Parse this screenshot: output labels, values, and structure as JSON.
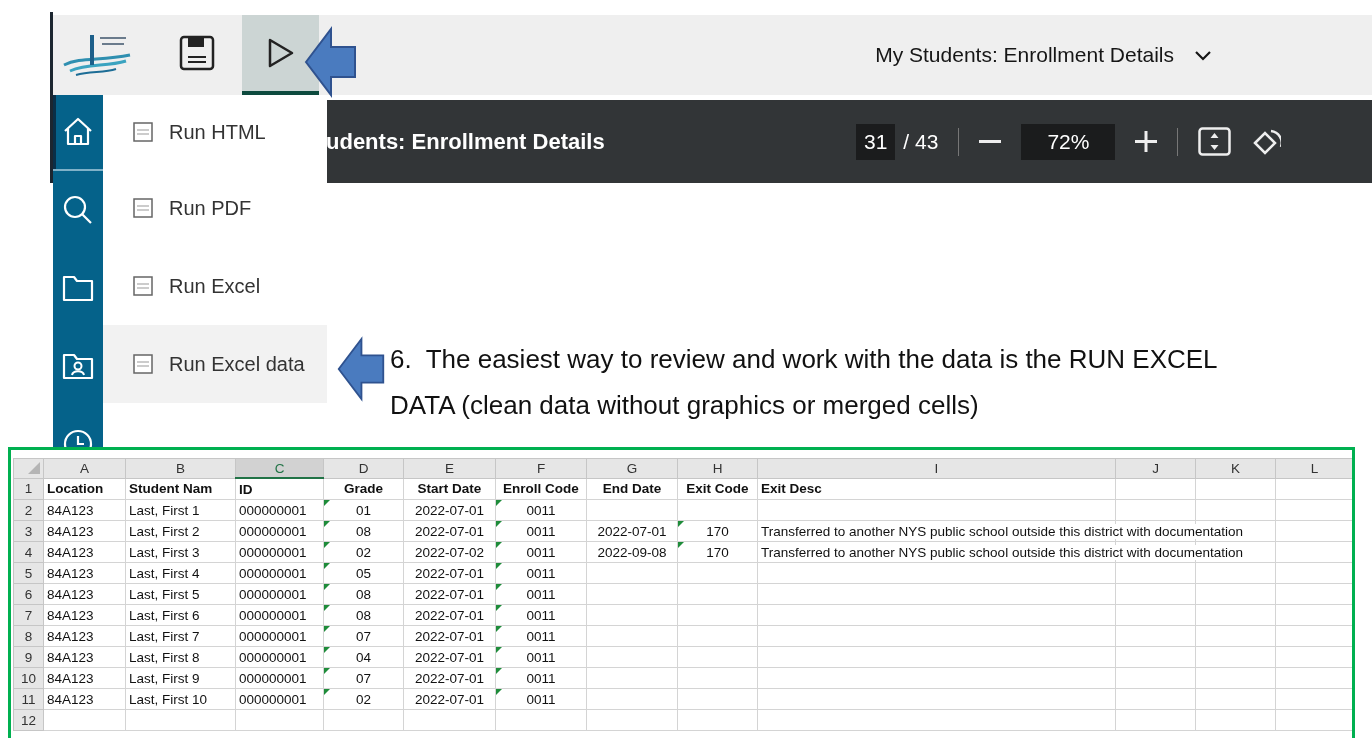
{
  "app_bar": {
    "buttons": [
      {
        "kind": "logo",
        "selected": false
      },
      {
        "kind": "save",
        "selected": false
      },
      {
        "kind": "run",
        "selected": true
      }
    ],
    "title": "My Students: Enrollment Details"
  },
  "sidebar": {
    "items": [
      {
        "kind": "home",
        "selected": true
      },
      {
        "kind": "search",
        "selected": false
      },
      {
        "kind": "folder",
        "selected": false
      },
      {
        "kind": "folder-user",
        "selected": false
      },
      {
        "kind": "clock",
        "selected": false
      }
    ]
  },
  "run_menu": {
    "items": [
      {
        "label": "Run HTML",
        "highlighted": false
      },
      {
        "label": "Run PDF",
        "highlighted": false
      },
      {
        "label": "Run Excel",
        "highlighted": false
      },
      {
        "label": "Run Excel data",
        "highlighted": true
      }
    ]
  },
  "report_toolbar": {
    "title": "udents: Enrollment Details",
    "page": "31",
    "page_total": "/ 43",
    "zoom": "72%"
  },
  "instruction": "6.  The easiest way to review and work with the data is the RUN EXCEL DATA (clean data without graphics or merged cells)",
  "spreadsheet": {
    "columns": [
      {
        "letter": "A",
        "kind": "text",
        "selected": false
      },
      {
        "letter": "B",
        "kind": "text",
        "selected": false
      },
      {
        "letter": "C",
        "kind": "text",
        "selected": true
      },
      {
        "letter": "D",
        "kind": "code",
        "flagged": true,
        "selected": false
      },
      {
        "letter": "E",
        "kind": "code",
        "selected": false
      },
      {
        "letter": "F",
        "kind": "code",
        "flagged": true,
        "selected": false
      },
      {
        "letter": "G",
        "kind": "code",
        "selected": false
      },
      {
        "letter": "H",
        "kind": "code",
        "flagged": true,
        "selected": false
      },
      {
        "letter": "I",
        "kind": "text",
        "selected": false
      },
      {
        "letter": "J",
        "kind": "text",
        "selected": false
      },
      {
        "letter": "K",
        "kind": "text",
        "selected": false
      },
      {
        "letter": "L",
        "kind": "text",
        "selected": false
      }
    ],
    "header_row": {
      "number": "1",
      "cells": [
        "Location",
        "Student Nam",
        "ID",
        "Grade",
        "Start Date",
        "Enroll Code",
        "End Date",
        "Exit Code",
        "Exit Desc",
        "",
        "",
        ""
      ]
    },
    "rows": [
      {
        "number": "2",
        "cells": [
          "84A123",
          "Last, First 1",
          "000000001",
          "01",
          "2022-07-01",
          "0011",
          "",
          "",
          "",
          "",
          "",
          ""
        ]
      },
      {
        "number": "3",
        "cells": [
          "84A123",
          "Last, First 2",
          "000000001",
          "08",
          "2022-07-01",
          "0011",
          "2022-07-01",
          "170",
          "Transferred to another NYS public school outside this district with documentation",
          "",
          "",
          ""
        ]
      },
      {
        "number": "4",
        "cells": [
          "84A123",
          "Last, First 3",
          "000000001",
          "02",
          "2022-07-02",
          "0011",
          "2022-09-08",
          "170",
          "Transferred to another NYS public school outside this district with documentation",
          "",
          "",
          ""
        ]
      },
      {
        "number": "5",
        "cells": [
          "84A123",
          "Last, First 4",
          "000000001",
          "05",
          "2022-07-01",
          "0011",
          "",
          "",
          "",
          "",
          "",
          ""
        ]
      },
      {
        "number": "6",
        "cells": [
          "84A123",
          "Last, First 5",
          "000000001",
          "08",
          "2022-07-01",
          "0011",
          "",
          "",
          "",
          "",
          "",
          ""
        ]
      },
      {
        "number": "7",
        "cells": [
          "84A123",
          "Last, First 6",
          "000000001",
          "08",
          "2022-07-01",
          "0011",
          "",
          "",
          "",
          "",
          "",
          ""
        ]
      },
      {
        "number": "8",
        "cells": [
          "84A123",
          "Last, First 7",
          "000000001",
          "07",
          "2022-07-01",
          "0011",
          "",
          "",
          "",
          "",
          "",
          ""
        ]
      },
      {
        "number": "9",
        "cells": [
          "84A123",
          "Last, First 8",
          "000000001",
          "04",
          "2022-07-01",
          "0011",
          "",
          "",
          "",
          "",
          "",
          ""
        ]
      },
      {
        "number": "10",
        "cells": [
          "84A123",
          "Last, First 9",
          "000000001",
          "07",
          "2022-07-01",
          "0011",
          "",
          "",
          "",
          "",
          "",
          ""
        ]
      },
      {
        "number": "11",
        "cells": [
          "84A123",
          "Last, First 10",
          "000000001",
          "02",
          "2022-07-01",
          "0011",
          "",
          "",
          "",
          "",
          "",
          ""
        ]
      },
      {
        "number": "12",
        "cells": [
          "",
          "",
          "",
          "",
          "",
          "",
          "",
          "",
          "",
          "",
          "",
          ""
        ]
      }
    ]
  }
}
